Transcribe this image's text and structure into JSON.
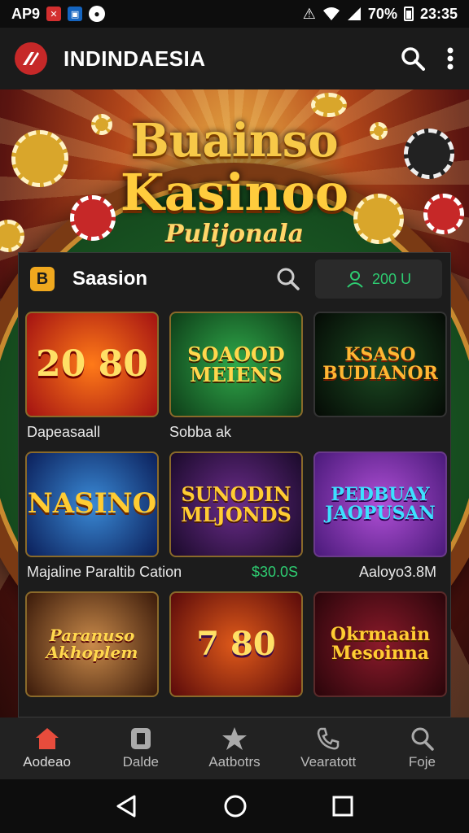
{
  "status_bar": {
    "carrier": "AP9",
    "battery": "70%",
    "time": "23:35"
  },
  "app_bar": {
    "title": "INDINDAESIA",
    "search_icon": "search-icon",
    "more_icon": "more-vert-icon"
  },
  "hero": {
    "line1": "Buainso",
    "line2": "Kasinoo",
    "line3": "Pulijonala"
  },
  "panel": {
    "title": "Saasion",
    "badge": "B",
    "balance": "200 U"
  },
  "tiles": [
    {
      "art_text": "20 80",
      "label": "Dapeasaall"
    },
    {
      "art_text": "SOAOOD MEIENS",
      "label": "Sobba ak"
    },
    {
      "art_text": "KSASO BUDIANOR",
      "label": ""
    },
    {
      "art_text": "NASINO",
      "label": "Majaline Paraltib Cation"
    },
    {
      "art_text": "SUNODIN MLJONDS",
      "label": "$30.0S"
    },
    {
      "art_text": "PEDBUAY JAOPUSAN",
      "label": "Aaloyo3.8M"
    },
    {
      "art_text": "Paranuso Akhoplem",
      "label": ""
    },
    {
      "art_text": "7 80",
      "label": ""
    },
    {
      "art_text": "Okrmaain Mesoinna",
      "label": ""
    }
  ],
  "bottom_nav": [
    {
      "label": "Aodeao",
      "icon": "home-icon"
    },
    {
      "label": "Dalde",
      "icon": "tablet-icon"
    },
    {
      "label": "Aatbotrs",
      "icon": "star-icon"
    },
    {
      "label": "Vearatott",
      "icon": "phone-icon"
    },
    {
      "label": "Foje",
      "icon": "user-search-icon"
    }
  ],
  "colors": {
    "accent_gold": "#f0a81e",
    "balance_green": "#2ecc71",
    "home_active": "#e74c3c"
  }
}
